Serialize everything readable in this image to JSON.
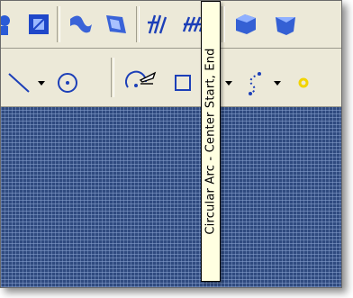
{
  "tooltip": {
    "text": "Circular Arc - Center Start, End"
  },
  "toolbar_top": {
    "icons": [
      "point-icon",
      "rectangle-face-icon",
      "curve-loft-icon",
      "surface-icon",
      "hatch-pattern-icon",
      "pattern-grid-icon",
      "solid-cube-icon",
      "solid-box-icon"
    ]
  },
  "toolbar_sketch": {
    "icons": [
      "line-icon",
      "circle-center-icon",
      "circular-arc-center-icon",
      "rectangle-icon",
      "spline-icon",
      "point-dot-icon"
    ]
  },
  "colors": {
    "canvas": "#2f4a7f",
    "toolbar": "#ece9d8",
    "tooltip_bg": "#ffffe1",
    "accent_yellow": "#f2d400"
  }
}
